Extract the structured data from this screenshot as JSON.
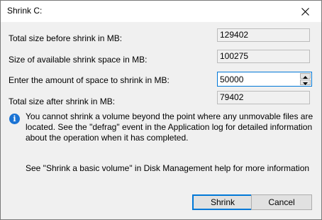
{
  "window": {
    "title": "Shrink C:",
    "close_icon": "close-icon"
  },
  "fields": {
    "total_size_label": "Total size before shrink in MB:",
    "total_size_value": "129402",
    "available_label": "Size of available shrink space in MB:",
    "available_value": "100275",
    "amount_label": "Enter the amount of space to shrink in MB:",
    "amount_value": "50000",
    "after_label": "Total size after shrink in MB:",
    "after_value": "79402"
  },
  "info": {
    "icon": "info-icon",
    "text": "You cannot shrink a volume beyond the point where any unmovable files are located. See the \"defrag\" event in the Application log for detailed information about the operation when it has completed."
  },
  "help": {
    "text": "See \"Shrink a basic volume\" in Disk Management help for more information"
  },
  "buttons": {
    "shrink_label": "Shrink",
    "cancel_label": "Cancel"
  },
  "colors": {
    "accent": "#0078d7",
    "info_icon": "#1a73d4",
    "dialog_bg": "#f0f0f0"
  }
}
